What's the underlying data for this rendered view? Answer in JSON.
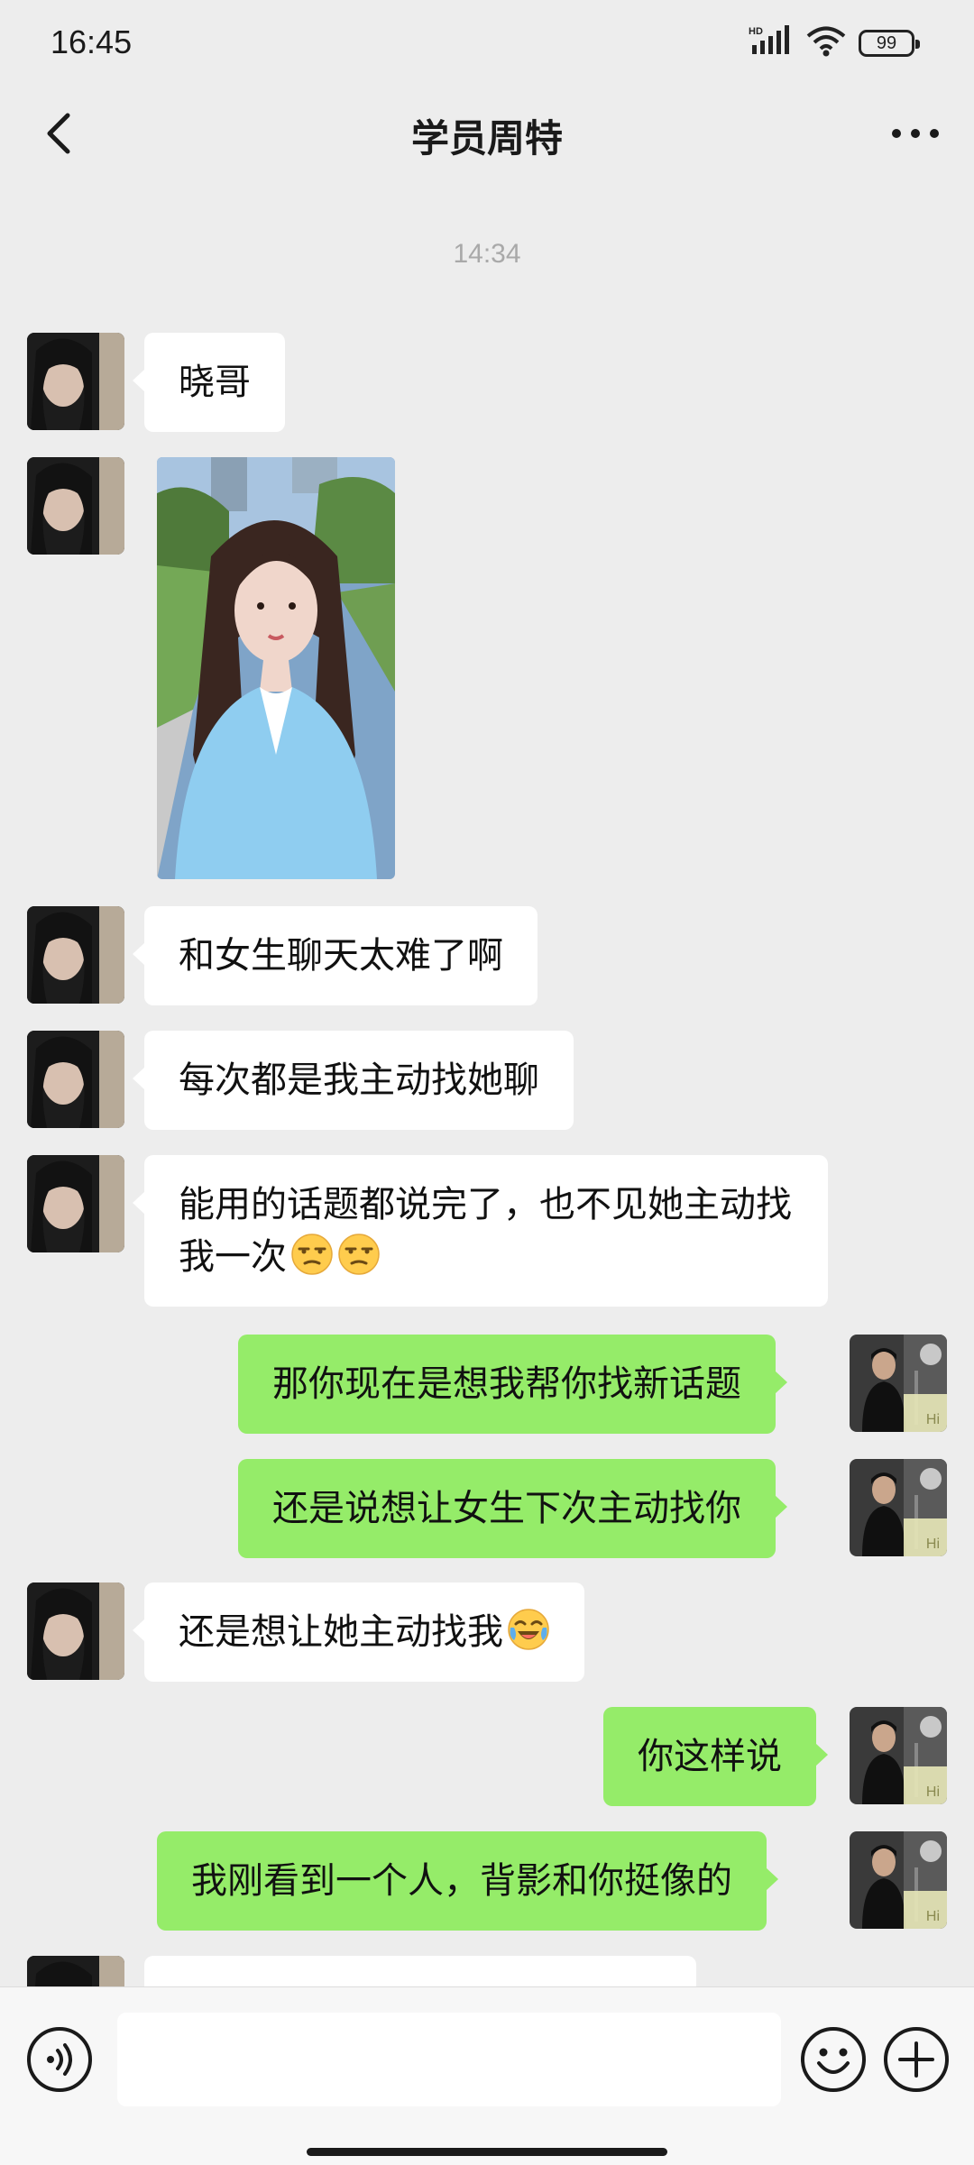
{
  "status_bar": {
    "time": "16:45",
    "network": "HD",
    "battery": "99"
  },
  "header": {
    "title": "学员周特"
  },
  "chat": {
    "timestamp": "14:34",
    "messages": [
      {
        "side": "in",
        "text": "晓哥"
      },
      {
        "side": "in",
        "type": "image",
        "description": "photo"
      },
      {
        "side": "in",
        "text": "和女生聊天太难了啊"
      },
      {
        "side": "in",
        "text": "每次都是我主动找她聊"
      },
      {
        "side": "in",
        "text": "能用的话题都说完了，也不见她主动找我一次",
        "emoji": [
          "unamused-face",
          "unamused-face"
        ]
      },
      {
        "side": "out",
        "text": "那你现在是想我帮你找新话题"
      },
      {
        "side": "out",
        "text": "还是说想让女生下次主动找你"
      },
      {
        "side": "in",
        "text": "还是想让她主动找我",
        "emoji": [
          "face-with-tears-of-joy"
        ]
      },
      {
        "side": "out",
        "text": "你这样说"
      },
      {
        "side": "out",
        "text": "我刚看到一个人，背影和你挺像的"
      }
    ],
    "avatar_badge": "Hi"
  },
  "input_bar": {
    "placeholder": ""
  },
  "colors": {
    "background": "#ededed",
    "outgoing_bubble": "#95ec69",
    "incoming_bubble": "#ffffff"
  }
}
